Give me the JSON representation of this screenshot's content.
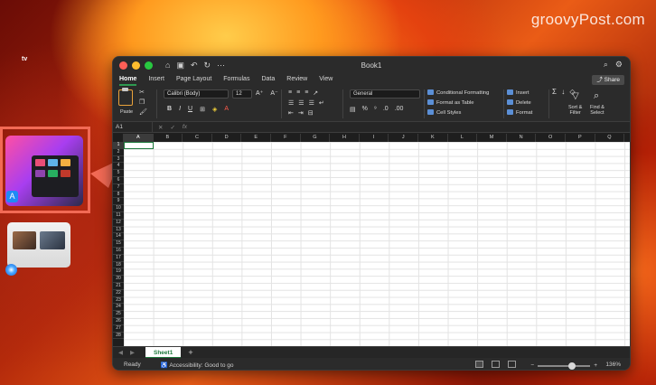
{
  "watermark": "groovyPost.com",
  "window": {
    "title": "Book1",
    "qat_icons": [
      "home-icon",
      "save-icon",
      "undo-icon",
      "redo-icon",
      "more-icon"
    ]
  },
  "ribbon_tabs": [
    "Home",
    "Insert",
    "Page Layout",
    "Formulas",
    "Data",
    "Review",
    "View"
  ],
  "active_tab": "Home",
  "share_label": "Share",
  "clipboard": {
    "paste_label": "Paste"
  },
  "font": {
    "name": "Calibri (Body)",
    "size": "12"
  },
  "number": {
    "format": "General"
  },
  "styles": {
    "conditional": "Conditional Formatting",
    "format_table": "Format as Table",
    "cell_styles": "Cell Styles"
  },
  "cells": {
    "insert": "Insert",
    "delete": "Delete",
    "format": "Format"
  },
  "editing": {
    "sort": "Sort &\nFilter",
    "find": "Find &\nSelect"
  },
  "formula_bar": {
    "name_box": "A1",
    "fx": "fx"
  },
  "columns": [
    "A",
    "B",
    "C",
    "D",
    "E",
    "F",
    "G",
    "H",
    "I",
    "J",
    "K",
    "L",
    "M",
    "N",
    "O",
    "P",
    "Q"
  ],
  "rows": [
    "1",
    "2",
    "3",
    "4",
    "5",
    "6",
    "7",
    "8",
    "9",
    "10",
    "11",
    "12",
    "13",
    "14",
    "15",
    "16",
    "17",
    "18",
    "19",
    "20",
    "21",
    "22",
    "23",
    "24",
    "25",
    "26",
    "27",
    "28"
  ],
  "sheet": {
    "tab": "Sheet1"
  },
  "status": {
    "ready": "Ready",
    "accessibility": "Accessibility: Good to go",
    "zoom": "136%"
  },
  "colors": {
    "highlight": "#f26a55",
    "excel_green": "#1e7a3c"
  }
}
